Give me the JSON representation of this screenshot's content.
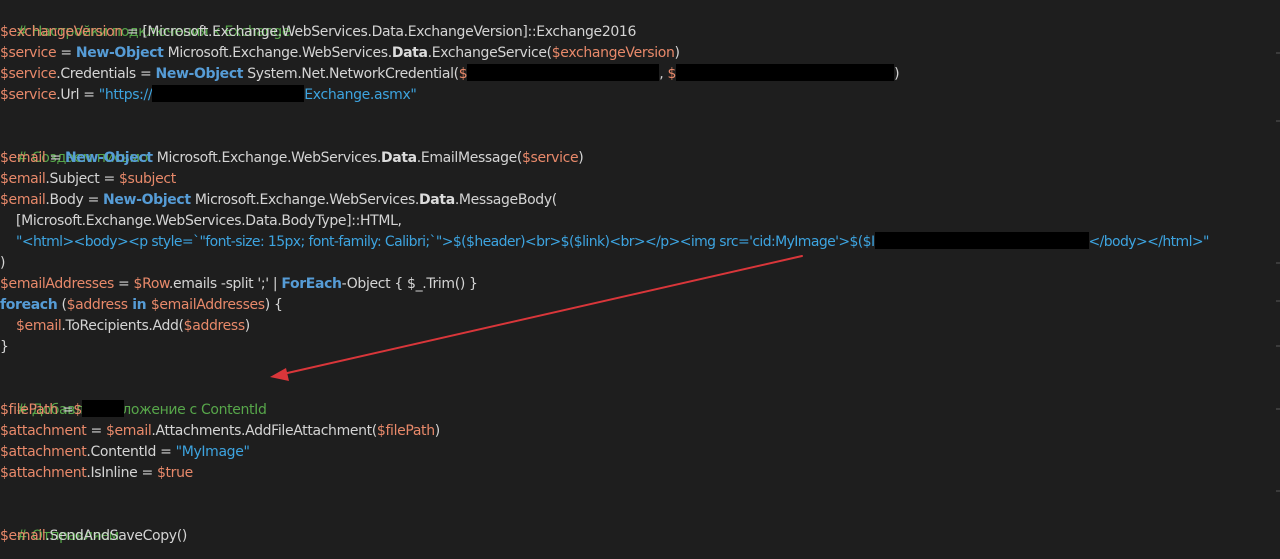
{
  "code": {
    "l1": {
      "comment": "# Настройки подключения к Exchange"
    },
    "l2": {
      "var": "$exchangeVersion",
      "eq": " = ",
      "rest": "[Microsoft.Exchange.WebServices.Data.ExchangeVersion]::Exchange2016"
    },
    "l3": {
      "var": "$service",
      "eq": " = ",
      "kw": "New-Object",
      "t1": " Microsoft.Exchange.WebServices.",
      "bold": "Data",
      "t2": ".ExchangeService(",
      "arg": "$exchangeVersion",
      "close": ")"
    },
    "l4": {
      "var": "$service",
      "t1": ".Credentials = ",
      "kw": "New-Object",
      "t2": " System.Net.NetworkCredential(",
      "d1": "$",
      "sep": ", ",
      "d2": "$",
      "close": ")"
    },
    "l5": {
      "var": "$service",
      "t1": ".Url = ",
      "s1": "\"https://",
      "s2": "Exchange.asmx\""
    },
    "l7": {
      "comment": "# Создаем письмо"
    },
    "l8": {
      "var": "$email",
      "eq": " = ",
      "kw": "New-Object",
      "t1": " Microsoft.Exchange.WebServices.",
      "bold": "Data",
      "t2": ".EmailMessage(",
      "arg": "$service",
      "close": ")"
    },
    "l9": {
      "var": "$email",
      "t1": ".Subject = ",
      "arg": "$subject"
    },
    "l10": {
      "var": "$email",
      "t1": ".Body = ",
      "kw": "New-Object",
      "t2": " Microsoft.Exchange.WebServices.",
      "bold": "Data",
      "t3": ".MessageBody("
    },
    "l11": {
      "text": "[Microsoft.Exchange.WebServices.Data.BodyType]::HTML,"
    },
    "l12": {
      "str": "\"<html><body><p style=`\"font-size: 15px; font-family: Calibri;`\">$($header)<br>$($link)<br></p><img src='cid:MyImage'>$($I",
      "str_end": "</body></html>\""
    },
    "l13": {
      "text": ")"
    },
    "l14": {
      "var": "$emailAddresses",
      "eq": " = ",
      "arg": "$Row",
      "t1": ".emails -split ';' | ",
      "kw": "ForEach",
      "t2": "-Object { $_.Trim() }"
    },
    "l15": {
      "kw1": "foreach",
      "t1": " (",
      "v1": "$address",
      "kw2": " in ",
      "v2": "$emailAddresses",
      "t2": ") {"
    },
    "l16": {
      "var": "$email",
      "t1": ".ToRecipients.Add(",
      "arg": "$address",
      "close": ")"
    },
    "l17": {
      "text": "}"
    },
    "l19": {
      "comment": "# Добавляем вложение с ContentId"
    },
    "l20": {
      "var": "$filePath",
      "t1": " =",
      "d1": "$"
    },
    "l21": {
      "var": "$attachment",
      "eq": " = ",
      "arg": "$email",
      "t1": ".Attachments.AddFileAttachment(",
      "arg2": "$filePath",
      "close": ")"
    },
    "l22": {
      "var": "$attachment",
      "t1": ".ContentId = ",
      "str": "\"MyImage\""
    },
    "l23": {
      "var": "$attachment",
      "t1": ".IsInline = ",
      "arg": "$true"
    },
    "l25": {
      "comment": "# Отправляем"
    },
    "l26": {
      "var": "$email",
      "t1": ".SendAndSaveCopy()"
    }
  },
  "colors": {
    "background": "#1e1e1e",
    "comment": "#57a64a",
    "variable": "#e8896a",
    "keyword": "#569cd6",
    "string": "#3da4e0",
    "annotation_arrow": "#d9363a"
  }
}
